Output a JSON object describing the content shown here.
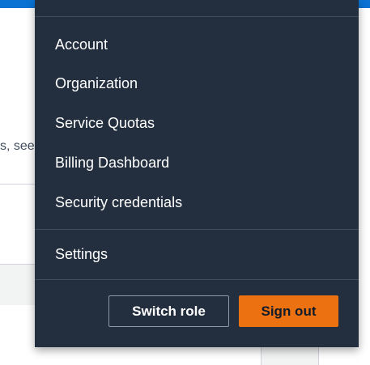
{
  "background": {
    "partial_text": "s, see"
  },
  "menu": {
    "items": [
      {
        "label": "Account"
      },
      {
        "label": "Organization"
      },
      {
        "label": "Service Quotas"
      },
      {
        "label": "Billing Dashboard"
      },
      {
        "label": "Security credentials"
      }
    ],
    "settings_label": "Settings",
    "switch_role_label": "Switch role",
    "sign_out_label": "Sign out"
  },
  "colors": {
    "menu_bg": "#232f3e",
    "divider": "#414d5c",
    "accent_orange": "#ec7211",
    "top_blue": "#0972d3"
  }
}
